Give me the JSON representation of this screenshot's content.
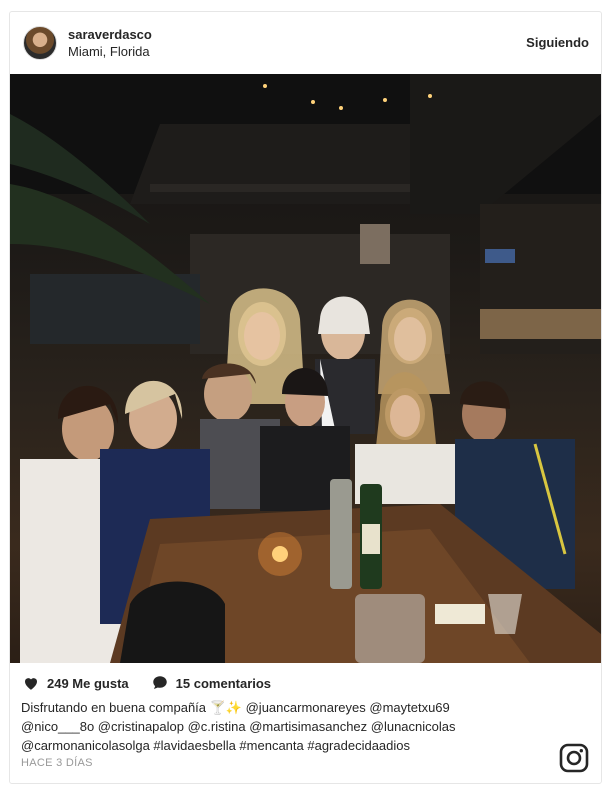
{
  "post": {
    "username": "saraverdasco",
    "location": "Miami, Florida",
    "follow_label": "Siguiendo",
    "likes": "249 Me gusta",
    "comments": "15 comentarios",
    "caption_lines": [
      "Disfrutando en buena compañía 🍸✨ @juancarmonareyes @maytetxu69",
      "@nico___8o @cristinapalop @c.ristina @martisimasanchez @lunacnicolas",
      "@carmonanicolasolga #lavidaesbella #mencanta #agradecidaadios"
    ],
    "time": "HACE 3 DÍAS"
  },
  "icons": {
    "like": "heart-icon",
    "comment": "comment-bubble-icon",
    "brand": "instagram-icon"
  },
  "colors": {
    "text": "#262626",
    "muted": "#999999",
    "border": "#e6e6e6"
  }
}
